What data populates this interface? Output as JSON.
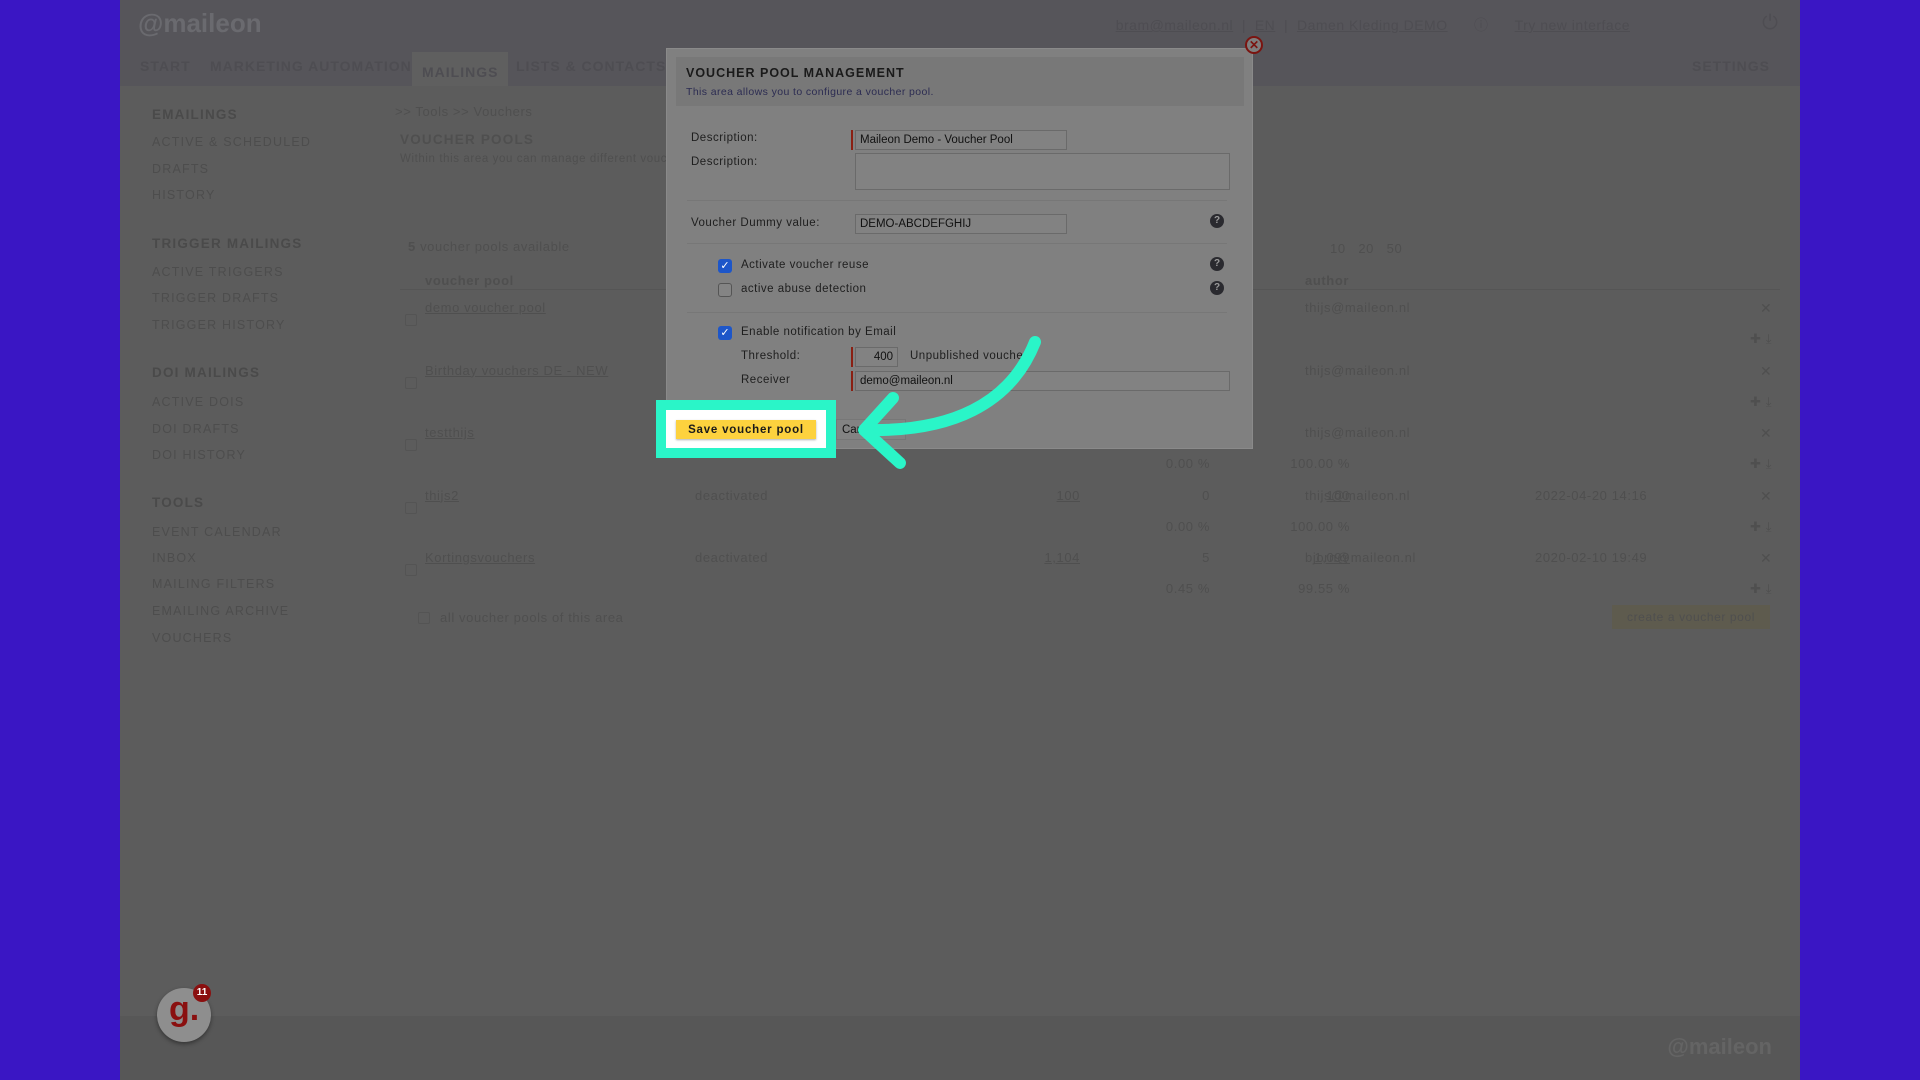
{
  "header": {
    "logo": "@maileon",
    "user_email": "bram@maileon.nl",
    "language": "EN",
    "account": "Damen Kleding DEMO",
    "try_new_interface": "Try new interface"
  },
  "nav": {
    "items": [
      "START",
      "MARKETING AUTOMATION",
      "MAILINGS",
      "LISTS & CONTACTS"
    ],
    "active": "MAILINGS",
    "settings": "SETTINGS"
  },
  "sidebar": {
    "sections": [
      {
        "title": "EMAILINGS",
        "items": [
          "ACTIVE & SCHEDULED",
          "DRAFTS",
          "HISTORY"
        ]
      },
      {
        "title": "TRIGGER MAILINGS",
        "items": [
          "ACTIVE TRIGGERS",
          "TRIGGER DRAFTS",
          "TRIGGER HISTORY"
        ]
      },
      {
        "title": "DOI MAILINGS",
        "items": [
          "ACTIVE DOIS",
          "DOI DRAFTS",
          "DOI HISTORY"
        ]
      },
      {
        "title": "TOOLS",
        "items": [
          "EVENT CALENDAR",
          "INBOX",
          "MAILING FILTERS",
          "EMAILING ARCHIVE",
          "VOUCHERS"
        ]
      }
    ]
  },
  "page": {
    "breadcrumb": ">> Tools  >> Vouchers",
    "title": "VOUCHER POOLS",
    "subtitle": "Within this area you can manage different voucher pools.",
    "count_number": "5",
    "count_text": "voucher pools available",
    "page_sizes": [
      "10",
      "20",
      "50"
    ],
    "col_voucher_pool": "voucher pool",
    "col_author": "author",
    "rows": [
      {
        "name": "demo voucher pool",
        "status": "",
        "total": "",
        "used": "",
        "available": "",
        "used_pct": "",
        "available_pct": "",
        "author": "thijs@maileon.nl",
        "date": ""
      },
      {
        "name": "Birthday vouchers DE - NEW",
        "status": "",
        "total": "",
        "used": "",
        "available": "",
        "used_pct": "",
        "available_pct": "",
        "author": "thijs@maileon.nl",
        "date": ""
      },
      {
        "name": "testthijs",
        "status": "",
        "total": "",
        "used": "",
        "available": "",
        "used_pct": "0.00 %",
        "available_pct": "100.00 %",
        "author": "thijs@maileon.nl",
        "date": ""
      },
      {
        "name": "thijs2",
        "status": "deactivated",
        "total": "100",
        "used": "0",
        "available": "100",
        "used_pct": "0.00 %",
        "available_pct": "100.00 %",
        "author": "thijs@maileon.nl",
        "date": "2022-04-20 14:16"
      },
      {
        "name": "Kortingsvouchers",
        "status": "deactivated",
        "total": "1,104",
        "used": "5",
        "available": "1,099",
        "used_pct": "0.45 %",
        "available_pct": "99.55 %",
        "author": "bjorn@maileon.nl",
        "date": "2020-02-10 19:49"
      }
    ],
    "select_all": "all voucher pools of this area",
    "create_button": "create a voucher pool"
  },
  "modal": {
    "title": "VOUCHER POOL MANAGEMENT",
    "subtitle": "This area allows you to configure a voucher pool.",
    "description_label": "Description:",
    "description_value": "Maileon Demo - Voucher Pool",
    "description2_label": "Description:",
    "description2_value": "",
    "dummy_label": "Voucher Dummy value:",
    "dummy_value": "DEMO-ABCDEFGHIJ",
    "reuse_label": "Activate voucher reuse",
    "reuse_checked": true,
    "abuse_label": "active abuse detection",
    "abuse_checked": false,
    "notify_label": "Enable notification by Email",
    "notify_checked": true,
    "threshold_label": "Threshold:",
    "threshold_value": "400",
    "threshold_unit": "Unpublished vouchers",
    "receiver_label": "Receiver",
    "receiver_value": "demo@maileon.nl",
    "save_label": "Save voucher pool",
    "cancel_label": "Cancel"
  },
  "badge": {
    "letter": "g.",
    "count": "11"
  },
  "footer": {
    "logo": "@maileon"
  },
  "colors": {
    "highlight": "#2af5c8",
    "save_button": "#fdd23e",
    "frame": "#3a16c4",
    "checkbox": "#1d56c9"
  }
}
